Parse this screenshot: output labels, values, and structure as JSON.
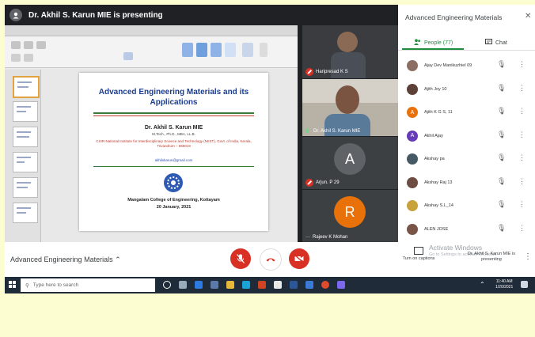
{
  "banner": {
    "text": "Dr. Akhil S. Karun MIE is presenting"
  },
  "slide": {
    "title": "Advanced Engineering Materials and its Applications",
    "author": "Dr. Akhil S. Karun MIE",
    "degrees": "M.Tech., Ph.D., MBA, LL.B.",
    "institute": "CSIR-National Institute for Interdisciplinary Science and Technology (NIIST), Govt. of India, Kerala, Trivandrum – 695019",
    "email": "akhilskarun@gmail.com",
    "college": "Mangalam College of Engineering, Kottayam",
    "date": "20 January, 2021"
  },
  "tiles": [
    {
      "name": "Haripresad K S",
      "muted": true
    },
    {
      "name": "Dr. Akhil S. Karun MIE",
      "muted": false
    },
    {
      "name": "Arjun. P 29",
      "initial": "A",
      "muted": true,
      "color": "#5f6368"
    },
    {
      "name": "Rajeev K Mohan",
      "initial": "R",
      "muted": false,
      "color": "#e8710a"
    }
  ],
  "panel": {
    "title": "Advanced Engineering Materials",
    "close_icon": "close-icon",
    "tab_people": "People (77)",
    "tab_chat": "Chat",
    "participants": [
      {
        "name": "Ajay Dev Manikuzhiel 09",
        "initial": "",
        "color": "#8d6e63"
      },
      {
        "name": "Ajith Joy 10",
        "initial": "",
        "color": "#5d4037"
      },
      {
        "name": "Ajith K G S, 11",
        "initial": "A",
        "color": "#e8710a"
      },
      {
        "name": "Akhil Ajay",
        "initial": "A",
        "color": "#673ab7"
      },
      {
        "name": "Akshay pa",
        "initial": "",
        "color": "#455a64"
      },
      {
        "name": "Akshay Raj 13",
        "initial": "",
        "color": "#6d4c41"
      },
      {
        "name": "Akshay S.L_14",
        "initial": "",
        "color": "#c8a23a"
      },
      {
        "name": "ALEN JOSE",
        "initial": "",
        "color": "#795548"
      }
    ]
  },
  "meetbar": {
    "meeting_name": "Advanced Engineering Materials",
    "captions_label": "Turn on captions",
    "presenting_label": "Dr. Akhil S. Karun MIE is presenting",
    "activate_title": "Activate Windows",
    "activate_sub": "Go to Settings to activate Windows."
  },
  "taskbar": {
    "search_placeholder": "Type here to search",
    "time": "11:40 AM",
    "date": "1/20/2021"
  }
}
